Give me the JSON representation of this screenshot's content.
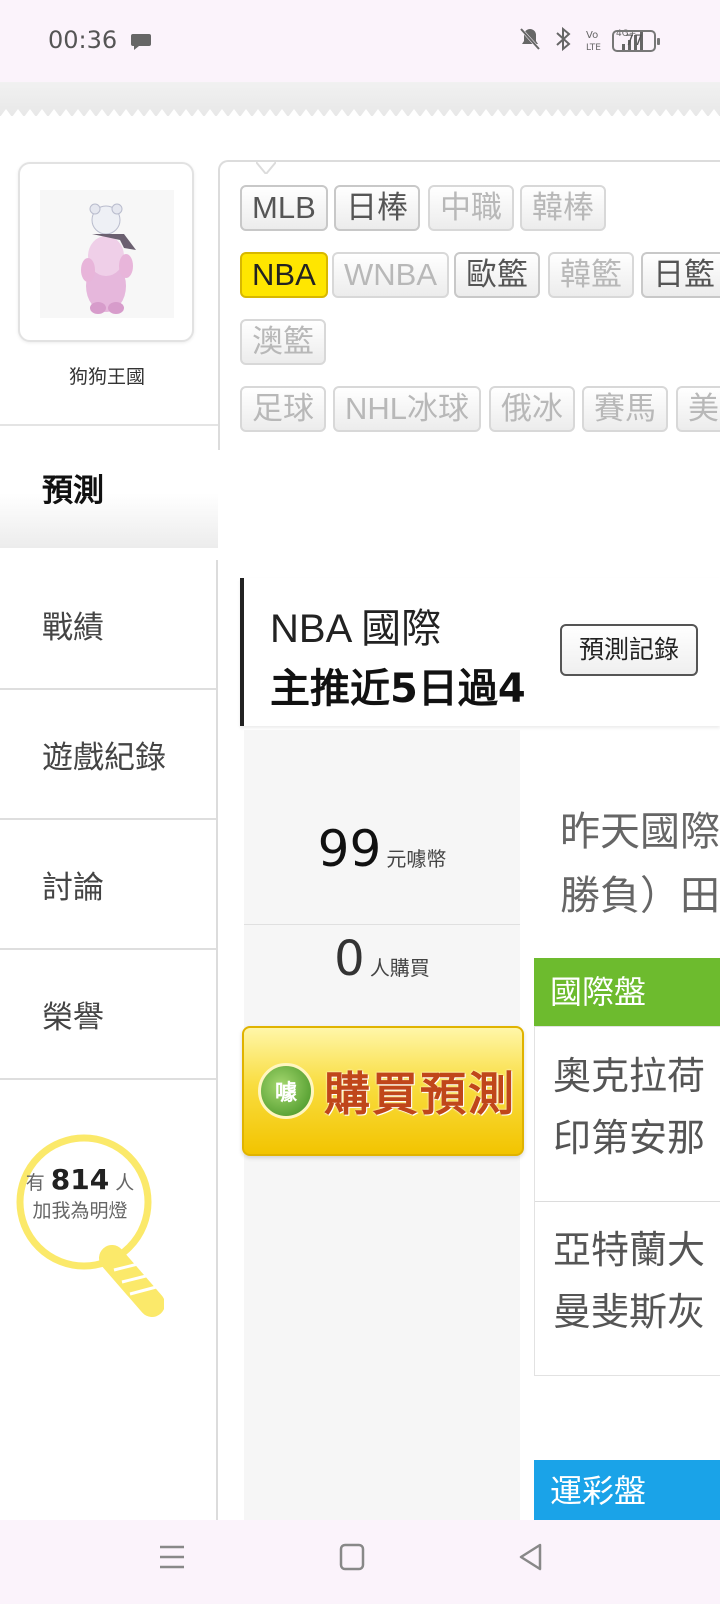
{
  "status_bar": {
    "time": "00:36",
    "battery": "77",
    "icons": [
      "chat-bubble-icon",
      "mute-bell-icon",
      "bluetooth-icon",
      "volte-icon",
      "signal-4g-icon",
      "battery-icon"
    ]
  },
  "profile": {
    "name": "狗狗王國"
  },
  "nav": {
    "items": [
      {
        "label": "預測",
        "active": true
      },
      {
        "label": "戰績"
      },
      {
        "label": "遊戲紀錄"
      },
      {
        "label": "討論"
      },
      {
        "label": "榮譽"
      }
    ]
  },
  "light": {
    "prefix": "有",
    "count": "814",
    "suffix": "人",
    "line2": "加我為明燈"
  },
  "leagues": {
    "row1": [
      "MLB",
      "日棒",
      "中職",
      "韓棒"
    ],
    "row2": [
      "NBA",
      "WNBA",
      "歐籃",
      "韓籃",
      "日籃"
    ],
    "row3": [
      "澳籃"
    ],
    "row4": [
      "足球",
      "NHL冰球",
      "俄冰",
      "賽馬",
      "美"
    ],
    "active": "NBA"
  },
  "header": {
    "title": "NBA 國際",
    "subtitle": "主推近5日過4",
    "record_button": "預測記錄"
  },
  "purchase": {
    "price": "99",
    "price_unit": "元噱幣",
    "buyers": "0",
    "buyers_unit": "人購買",
    "button_icon_text": "噱",
    "button_label": "購買預測"
  },
  "preview": {
    "line1": "昨天國際",
    "line2": "勝負）田"
  },
  "intl": {
    "tag": "國際盤",
    "games": [
      {
        "home": "奧克拉荷",
        "away": "印第安那"
      },
      {
        "home": "亞特蘭大",
        "away": "曼斐斯灰"
      }
    ]
  },
  "lottery": {
    "tag": "運彩盤"
  },
  "colors": {
    "active_pill": "#ffe600",
    "intl_tag": "#6dbb2e",
    "lottery_tag": "#1aa3e8",
    "buy_button": "#f9dd40",
    "bulb": "#fbe96a"
  }
}
